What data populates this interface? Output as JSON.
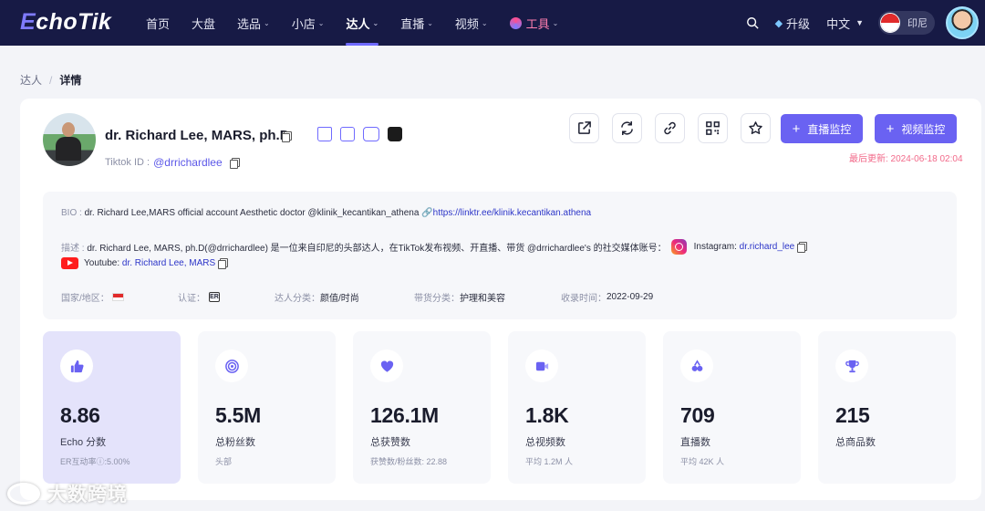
{
  "nav": {
    "logo_a": "E",
    "logo_b": "choTik",
    "items": [
      {
        "label": "首页",
        "caret": ""
      },
      {
        "label": "大盘",
        "caret": ""
      },
      {
        "label": "选品",
        "caret": "⌄"
      },
      {
        "label": "小店",
        "caret": "⌄"
      },
      {
        "label": "达人",
        "caret": "⌄"
      },
      {
        "label": "直播",
        "caret": "⌄"
      },
      {
        "label": "视频",
        "caret": "⌄"
      }
    ],
    "tools_label": "工具",
    "tools_caret": "⌄",
    "upgrade_label": "升级",
    "language": "中文",
    "country": "印尼"
  },
  "breadcrumb": {
    "parent": "达人",
    "separator": "/",
    "current": "详情"
  },
  "profile": {
    "name": "dr. Richard Lee, MARS, ph.D",
    "tiktok_id_label": "Tiktok ID :",
    "tiktok_handle": "@drrichardlee",
    "last_update": "最后更新: 2024-06-18 02:04",
    "btn_live_monitor": "直播监控",
    "btn_video_monitor": "视频监控",
    "plus": "+"
  },
  "info": {
    "bio_label": "BIO :",
    "bio_text": "dr. Richard Lee,MARS official account Aesthetic doctor @klinik_kecantikan_athena",
    "bio_link": "https://linktr.ee/klinik.kecantikan.athena",
    "desc_label": "描述 :",
    "desc_text": "dr. Richard Lee, MARS, ph.D(@drrichardlee) 是一位来自印尼的头部达人，在TikTok发布视频、开直播、带货 @drrichardlee's 的社交媒体账号：",
    "instagram_label": "Instagram:",
    "instagram_handle": "dr.richard_lee",
    "youtube_label": "Youtube:",
    "youtube_handle": "dr. Richard Lee, MARS",
    "region_label": "国家/地区：",
    "cert_label": "认证：",
    "cert_icon_text": "ER",
    "category_label": "达人分类：",
    "category_value": "颜值/时尚",
    "goods_category_label": "带货分类：",
    "goods_category_value": "护理和美容",
    "indexed_label": "收录时间：",
    "indexed_value": "2022-09-29"
  },
  "stats": [
    {
      "icon": "thumbs-up-icon",
      "value": "8.86",
      "label": "Echo 分数",
      "sub": "ER互动率ⓘ:5.00%"
    },
    {
      "icon": "target-icon",
      "value": "5.5M",
      "label": "总粉丝数",
      "sub": "头部"
    },
    {
      "icon": "heart-icon",
      "value": "126.1M",
      "label": "总获赞数",
      "sub": "获赞数/粉丝数: 22.88"
    },
    {
      "icon": "video-icon",
      "value": "1.8K",
      "label": "总视频数",
      "sub": "平均 1.2M 人"
    },
    {
      "icon": "live-icon",
      "value": "709",
      "label": "直播数",
      "sub": "平均 42K 人"
    },
    {
      "icon": "trophy-icon",
      "value": "215",
      "label": "总商品数",
      "sub": ""
    }
  ],
  "watermark": "大数跨境",
  "colors": {
    "nav_bg": "#171a45",
    "accent": "#6a62f2",
    "update_text": "#f26a8a",
    "link": "#2c35c8"
  }
}
